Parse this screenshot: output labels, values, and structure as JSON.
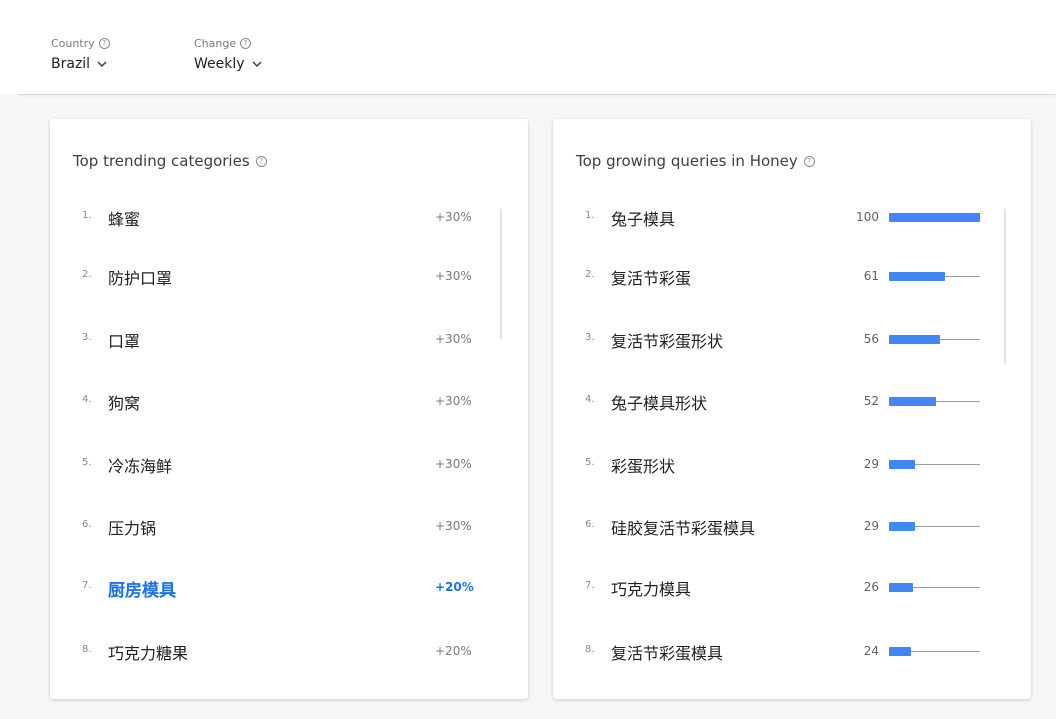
{
  "filters": {
    "country": {
      "label": "Country",
      "value": "Brazil"
    },
    "change": {
      "label": "Change",
      "value": "Weekly"
    }
  },
  "categories": {
    "title": "Top trending categories",
    "items": [
      {
        "rank": "1.",
        "label": "蜂蜜",
        "change": "+30%"
      },
      {
        "rank": "2.",
        "label": "防护口罩",
        "change": "+30%"
      },
      {
        "rank": "3.",
        "label": "口罩",
        "change": "+30%"
      },
      {
        "rank": "4.",
        "label": "狗窝",
        "change": "+30%"
      },
      {
        "rank": "5.",
        "label": "冷冻海鲜",
        "change": "+30%"
      },
      {
        "rank": "6.",
        "label": "压力锅",
        "change": "+30%"
      },
      {
        "rank": "7.",
        "label": "厨房模具",
        "change": "+20%"
      },
      {
        "rank": "8.",
        "label": "巧克力糖果",
        "change": "+20%"
      }
    ],
    "highlighted_index": 6
  },
  "queries": {
    "title": "Top growing queries in Honey",
    "items": [
      {
        "rank": "1.",
        "label": "兔子模具",
        "value": 100
      },
      {
        "rank": "2.",
        "label": "复活节彩蛋",
        "value": 61
      },
      {
        "rank": "3.",
        "label": "复活节彩蛋形状",
        "value": 56
      },
      {
        "rank": "4.",
        "label": "兔子模具形状",
        "value": 52
      },
      {
        "rank": "5.",
        "label": "彩蛋形状",
        "value": 29
      },
      {
        "rank": "6.",
        "label": "硅胶复活节彩蛋模具",
        "value": 29
      },
      {
        "rank": "7.",
        "label": "巧克力模具",
        "value": 26
      },
      {
        "rank": "8.",
        "label": "复活节彩蛋模具",
        "value": 24
      }
    ],
    "max_value": 100
  },
  "colors": {
    "accent": "#1a73e8",
    "bar": "#4285f4",
    "track": "#9aa0a6"
  },
  "icons": {
    "help": "help-circle-icon",
    "dropdown": "chevron-down-icon"
  }
}
